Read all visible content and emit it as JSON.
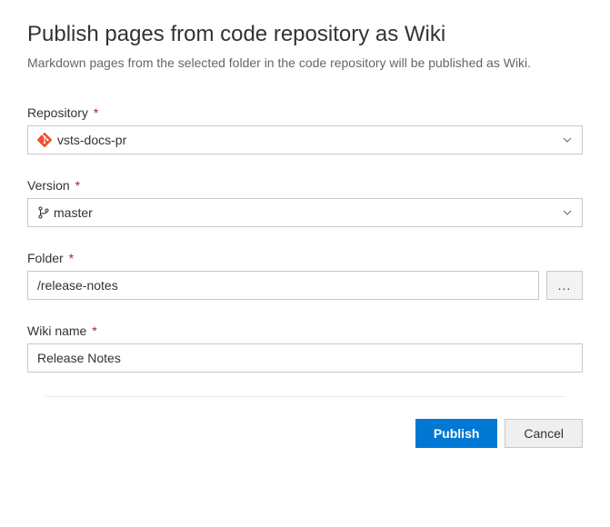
{
  "title": "Publish pages from code repository as Wiki",
  "subtitle": "Markdown pages from the selected folder in the code repository will be published as Wiki.",
  "fields": {
    "repository": {
      "label": "Repository",
      "value": "vsts-docs-pr"
    },
    "version": {
      "label": "Version",
      "value": "master"
    },
    "folder": {
      "label": "Folder",
      "value": "/release-notes",
      "browse": "..."
    },
    "wikiName": {
      "label": "Wiki name",
      "value": "Release Notes"
    }
  },
  "requiredMark": "*",
  "buttons": {
    "publish": "Publish",
    "cancel": "Cancel"
  }
}
